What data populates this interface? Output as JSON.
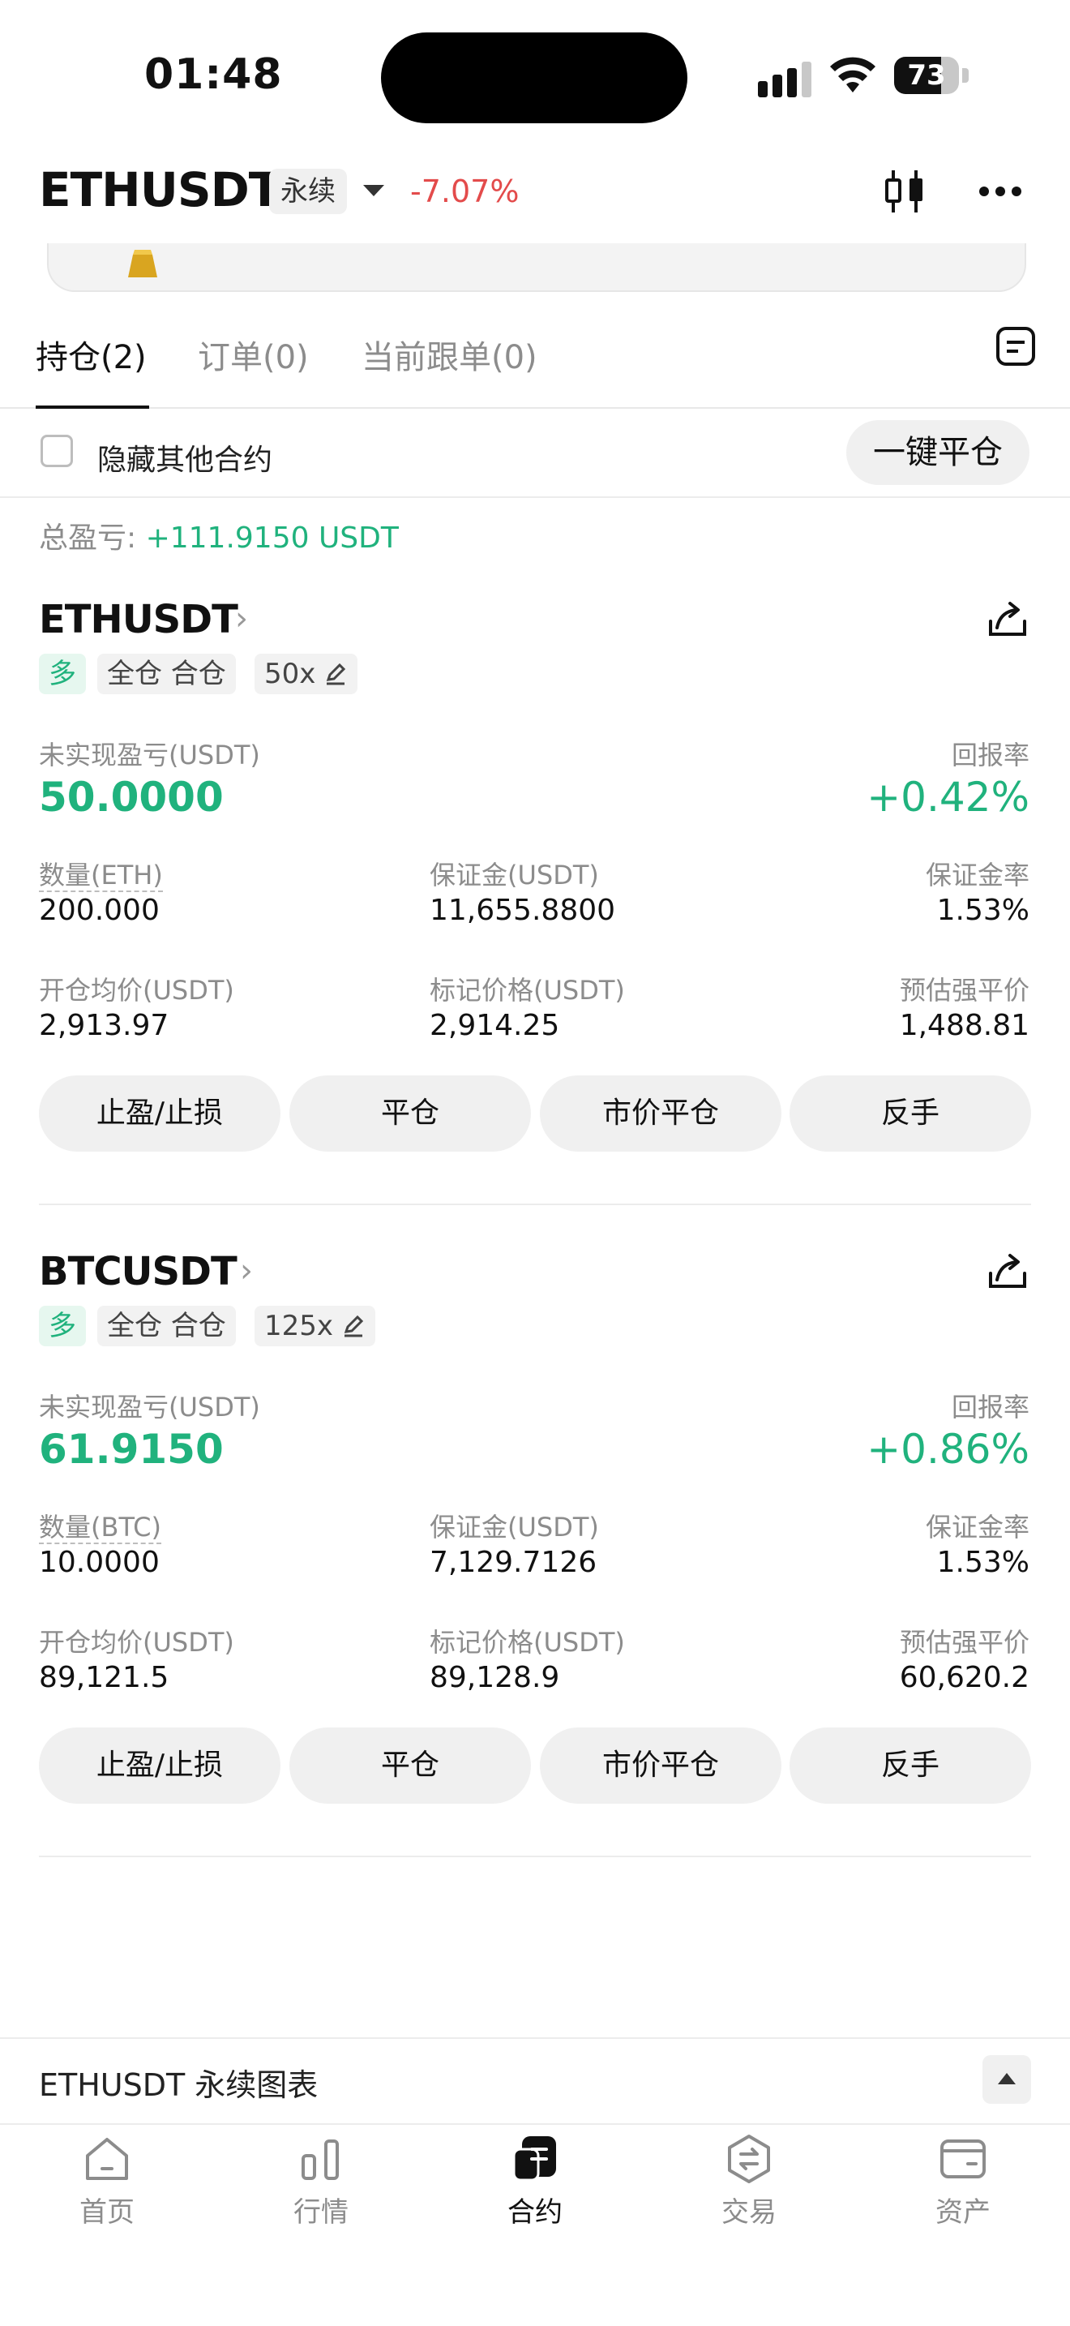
{
  "status_bar": {
    "time": "01:48",
    "battery": "73",
    "battery_level": 0.73
  },
  "header": {
    "symbol": "ETHUSDT",
    "contract_type": "永续",
    "change": "-7.07%",
    "icons": [
      "candlestick-icon",
      "more-icon"
    ]
  },
  "tabs": [
    {
      "label": "持仓(2)",
      "active": true
    },
    {
      "label": "订单(0)",
      "active": false
    },
    {
      "label": "当前跟单(0)",
      "active": false
    }
  ],
  "filter": {
    "hide_other": "隐藏其他合约",
    "close_all": "一键平仓"
  },
  "summary": {
    "label": "总盈亏: ",
    "value": "+111.9150 USDT"
  },
  "positions": [
    {
      "pair": "ETHUSDT",
      "side": "多",
      "mode": "全仓 合仓",
      "leverage": "50x",
      "unrealized_label": "未实现盈亏(USDT)",
      "unrealized": "50.0000",
      "roe_label": "回报率",
      "roe": "+0.42%",
      "qty_label": "数量(ETH)",
      "qty": "200.000",
      "margin_label": "保证金(USDT)",
      "margin": "11,655.8800",
      "margin_ratio_label": "保证金率",
      "margin_ratio": "1.53%",
      "entry_label": "开仓均价(USDT)",
      "entry": "2,913.97",
      "mark_label": "标记价格(USDT)",
      "mark": "2,914.25",
      "liq_label": "预估强平价",
      "liq": "1,488.81",
      "buttons": [
        "止盈/止损",
        "平仓",
        "市价平仓",
        "反手"
      ]
    },
    {
      "pair": "BTCUSDT",
      "side": "多",
      "mode": "全仓 合仓",
      "leverage": "125x",
      "unrealized_label": "未实现盈亏(USDT)",
      "unrealized": "61.9150",
      "roe_label": "回报率",
      "roe": "+0.86%",
      "qty_label": "数量(BTC)",
      "qty": "10.0000",
      "margin_label": "保证金(USDT)",
      "margin": "7,129.7126",
      "margin_ratio_label": "保证金率",
      "margin_ratio": "1.53%",
      "entry_label": "开仓均价(USDT)",
      "entry": "89,121.5",
      "mark_label": "标记价格(USDT)",
      "mark": "89,128.9",
      "liq_label": "预估强平价",
      "liq": "60,620.2",
      "buttons": [
        "止盈/止损",
        "平仓",
        "市价平仓",
        "反手"
      ]
    }
  ],
  "chart_bar": {
    "label": "ETHUSDT 永续图表"
  },
  "bottom_nav": [
    {
      "label": "首页",
      "icon": "home-icon",
      "active": false
    },
    {
      "label": "行情",
      "icon": "market-icon",
      "active": false
    },
    {
      "label": "合约",
      "icon": "futures-icon",
      "active": true
    },
    {
      "label": "交易",
      "icon": "trade-icon",
      "active": false
    },
    {
      "label": "资产",
      "icon": "wallet-icon",
      "active": false
    }
  ],
  "colors": {
    "up": "#20b27d",
    "down": "#e34b4b",
    "muted": "#8c8c8c"
  }
}
